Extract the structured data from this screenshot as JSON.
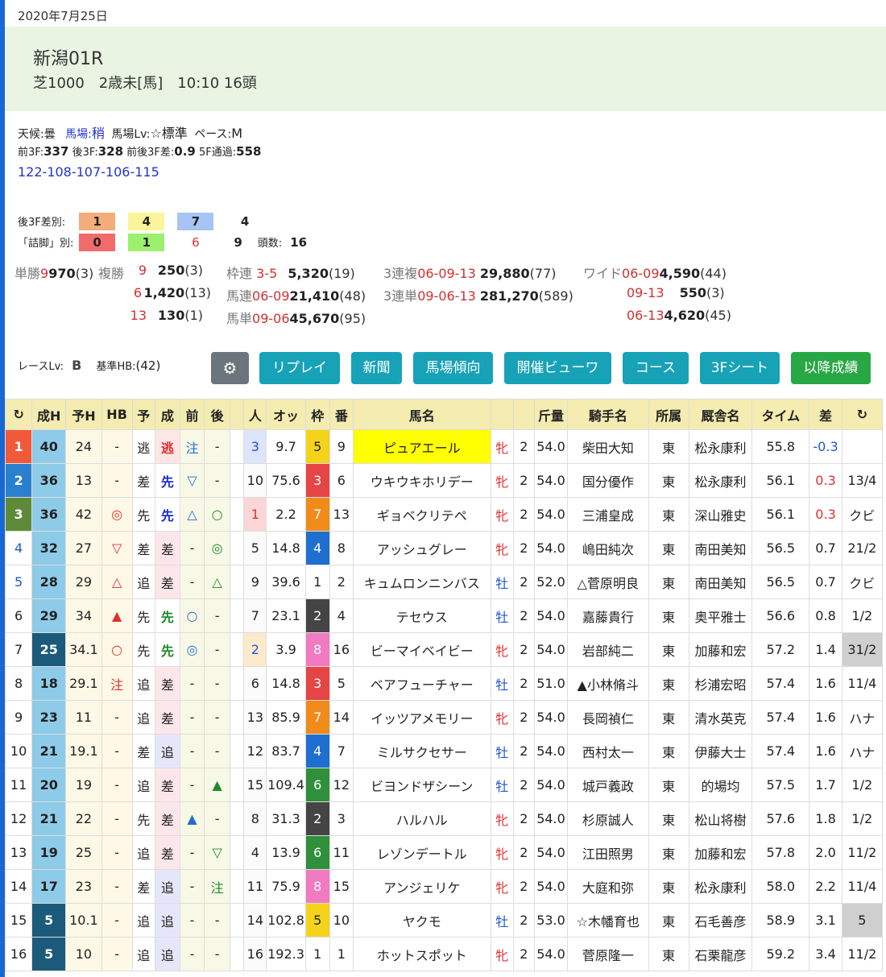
{
  "date": "2020年7月25日",
  "race": {
    "title": "新潟01R",
    "sub": "芝1000　2歳未[馬]　10:10 16頭"
  },
  "cond": {
    "weather_label": "天候:",
    "weather": "曇",
    "baba_label": "馬場:",
    "baba": "稍",
    "babalv_label": "馬場Lv:",
    "babalv": "☆標準",
    "pace_label": "ペース:",
    "pace": "M",
    "f3_label": "前3F:",
    "f3": "337",
    "l3_label": "後3F:",
    "l3": "328",
    "diff_label": "前後3F差:",
    "diff": "0.9",
    "f5_label": "5F通過:",
    "f5": "558",
    "laps": "122-108-107-106-115"
  },
  "stats": {
    "l3_label": "後3F差別:",
    "l3_values": [
      "1",
      "4",
      "7",
      "4"
    ],
    "tsume_label": "「詰脚」別:",
    "tsume_values": [
      "0",
      "1",
      "6",
      "9"
    ],
    "heads_label": "頭数:",
    "heads": "16"
  },
  "payouts": {
    "tan_label": "単勝",
    "tan_num": "9",
    "tan_val": "970",
    "tan_pop": "(3)",
    "fuku_label": "複勝",
    "fuku": [
      {
        "num": "9",
        "val": "250",
        "pop": "(3)"
      },
      {
        "num": "6",
        "val": "1,420",
        "pop": "(13)"
      },
      {
        "num": "13",
        "val": "130",
        "pop": "(1)"
      }
    ],
    "waku_label": "枠連",
    "waku_num": "3-5",
    "waku_val": "5,320",
    "waku_pop": "(19)",
    "umaren_label": "馬連",
    "umaren_num": "06-09",
    "umaren_val": "21,410",
    "umaren_pop": "(48)",
    "umatan_label": "馬単",
    "umatan_num": "09-06",
    "umatan_val": "45,670",
    "umatan_pop": "(95)",
    "trio_label": "3連複",
    "trio_num": "06-09-13",
    "trio_val": "29,880",
    "trio_pop": "(77)",
    "trifecta_label": "3連単",
    "trifecta_num": "09-06-13",
    "trifecta_val": "281,270",
    "trifecta_pop": "(589)",
    "wide_label": "ワイド",
    "wide": [
      {
        "num": "06-09",
        "val": "4,590",
        "pop": "(44)"
      },
      {
        "num": "09-13",
        "val": "550",
        "pop": "(3)"
      },
      {
        "num": "06-13",
        "val": "4,620",
        "pop": "(45)"
      }
    ]
  },
  "racelv": {
    "label": "レースLv:",
    "value": "B",
    "hb_label": "基準HB:",
    "hb": "(42)"
  },
  "buttons": [
    "リプレイ",
    "新聞",
    "馬場傾向",
    "開催ビューワ",
    "コース",
    "3Fシート",
    "以降成績"
  ],
  "colors": {
    "btn_teal": "#17a2b8",
    "btn_green": "#28a745",
    "btn_gray": "#6c757d",
    "header_bg": "#e9f4e2"
  },
  "table": {
    "headers": [
      "↻",
      "成H",
      "予H",
      "HB",
      "予",
      "成",
      "前",
      "後",
      "",
      "人",
      "オッ",
      "枠",
      "番",
      "馬名",
      "",
      "",
      "斤量",
      "騎手名",
      "所属",
      "厩舎名",
      "タイム",
      "差",
      "↻"
    ],
    "rows": [
      {
        "rank": "1",
        "seih": "40",
        "yoh": "24",
        "hb": "-",
        "yo": "逃",
        "sei": "逃",
        "mae": "注",
        "ato": "-",
        "ninki": "3",
        "odds": "9.7",
        "waku": "5",
        "ban": "9",
        "name": "ピュアエール",
        "sex": "牝",
        "age": "2",
        "kin": "54.0",
        "jockey": "柴田大知",
        "aff": "東",
        "trainer": "松永康利",
        "time": "55.8",
        "sa": "-0.3",
        "mg": ""
      },
      {
        "rank": "2",
        "seih": "36",
        "yoh": "13",
        "hb": "-",
        "yo": "差",
        "sei": "先",
        "mae": "▽",
        "ato": "-",
        "ninki": "10",
        "odds": "75.6",
        "waku": "3",
        "ban": "6",
        "name": "ウキウキホリデー",
        "sex": "牝",
        "age": "2",
        "kin": "54.0",
        "jockey": "国分優作",
        "aff": "東",
        "trainer": "松永康利",
        "time": "56.1",
        "sa": "0.3",
        "mg": "13/4"
      },
      {
        "rank": "3",
        "seih": "36",
        "yoh": "42",
        "hb": "◎",
        "yo": "先",
        "sei": "先",
        "mae": "△",
        "ato": "○",
        "ninki": "1",
        "odds": "2.2",
        "waku": "7",
        "ban": "13",
        "name": "ギョベクリテペ",
        "sex": "牝",
        "age": "2",
        "kin": "54.0",
        "jockey": "三浦皇成",
        "aff": "東",
        "trainer": "深山雅史",
        "time": "56.1",
        "sa": "0.3",
        "mg": "クビ"
      },
      {
        "rank": "4",
        "seih": "32",
        "yoh": "27",
        "hb": "▽",
        "yo": "差",
        "sei": "差",
        "mae": "-",
        "ato": "◎",
        "ninki": "5",
        "odds": "14.8",
        "waku": "4",
        "ban": "8",
        "name": "アッシュグレー",
        "sex": "牝",
        "age": "2",
        "kin": "54.0",
        "jockey": "嶋田純次",
        "aff": "東",
        "trainer": "南田美知",
        "time": "56.5",
        "sa": "0.7",
        "mg": "21/2"
      },
      {
        "rank": "5",
        "seih": "28",
        "yoh": "29",
        "hb": "△",
        "yo": "追",
        "sei": "差",
        "mae": "-",
        "ato": "△",
        "ninki": "9",
        "odds": "39.6",
        "waku": "1",
        "ban": "2",
        "name": "キュムロンニンバス",
        "sex": "牡",
        "age": "2",
        "kin": "52.0",
        "jockey": "△菅原明良",
        "aff": "東",
        "trainer": "南田美知",
        "time": "56.5",
        "sa": "0.7",
        "mg": "クビ"
      },
      {
        "rank": "6",
        "seih": "29",
        "yoh": "34",
        "hb": "▲",
        "yo": "先",
        "sei": "先",
        "mae": "○",
        "ato": "-",
        "ninki": "7",
        "odds": "23.1",
        "waku": "2",
        "ban": "4",
        "name": "テセウス",
        "sex": "牡",
        "age": "2",
        "kin": "54.0",
        "jockey": "嘉藤貴行",
        "aff": "東",
        "trainer": "奥平雅士",
        "time": "56.6",
        "sa": "0.8",
        "mg": "1/2"
      },
      {
        "rank": "7",
        "seih": "25",
        "yoh": "34.1",
        "hb": "○",
        "yo": "先",
        "sei": "先",
        "mae": "◎",
        "ato": "-",
        "ninki": "2",
        "odds": "3.9",
        "waku": "8",
        "ban": "16",
        "name": "ビーマイベイビー",
        "sex": "牝",
        "age": "2",
        "kin": "54.0",
        "jockey": "岩部純二",
        "aff": "東",
        "trainer": "加藤和宏",
        "time": "57.2",
        "sa": "1.4",
        "mg": "31/2"
      },
      {
        "rank": "8",
        "seih": "18",
        "yoh": "29.1",
        "hb": "注",
        "yo": "追",
        "sei": "差",
        "mae": "-",
        "ato": "-",
        "ninki": "6",
        "odds": "14.8",
        "waku": "3",
        "ban": "5",
        "name": "ベアフューチャー",
        "sex": "牡",
        "age": "2",
        "kin": "51.0",
        "jockey": "▲小林脩斗",
        "aff": "東",
        "trainer": "杉浦宏昭",
        "time": "57.4",
        "sa": "1.6",
        "mg": "11/4"
      },
      {
        "rank": "9",
        "seih": "23",
        "yoh": "11",
        "hb": "-",
        "yo": "追",
        "sei": "差",
        "mae": "-",
        "ato": "-",
        "ninki": "13",
        "odds": "85.9",
        "waku": "7",
        "ban": "14",
        "name": "イッツアメモリー",
        "sex": "牝",
        "age": "2",
        "kin": "54.0",
        "jockey": "長岡禎仁",
        "aff": "東",
        "trainer": "清水英克",
        "time": "57.4",
        "sa": "1.6",
        "mg": "ハナ"
      },
      {
        "rank": "10",
        "seih": "21",
        "yoh": "19.1",
        "hb": "-",
        "yo": "差",
        "sei": "追",
        "mae": "-",
        "ato": "-",
        "ninki": "12",
        "odds": "83.7",
        "waku": "4",
        "ban": "7",
        "name": "ミルサクセサー",
        "sex": "牡",
        "age": "2",
        "kin": "54.0",
        "jockey": "西村太一",
        "aff": "東",
        "trainer": "伊藤大士",
        "time": "57.4",
        "sa": "1.6",
        "mg": "ハナ"
      },
      {
        "rank": "11",
        "seih": "20",
        "yoh": "19",
        "hb": "-",
        "yo": "追",
        "sei": "差",
        "mae": "-",
        "ato": "▲",
        "ninki": "15",
        "odds": "109.4",
        "waku": "6",
        "ban": "12",
        "name": "ビヨンドザシーン",
        "sex": "牡",
        "age": "2",
        "kin": "54.0",
        "jockey": "城戸義政",
        "aff": "東",
        "trainer": "的場均",
        "time": "57.5",
        "sa": "1.7",
        "mg": "1/2"
      },
      {
        "rank": "12",
        "seih": "21",
        "yoh": "22",
        "hb": "-",
        "yo": "先",
        "sei": "差",
        "mae": "▲",
        "ato": "-",
        "ninki": "8",
        "odds": "31.3",
        "waku": "2",
        "ban": "3",
        "name": "ハルハル",
        "sex": "牝",
        "age": "2",
        "kin": "54.0",
        "jockey": "杉原誠人",
        "aff": "東",
        "trainer": "松山将樹",
        "time": "57.6",
        "sa": "1.8",
        "mg": "1/2"
      },
      {
        "rank": "13",
        "seih": "19",
        "yoh": "25",
        "hb": "-",
        "yo": "追",
        "sei": "差",
        "mae": "-",
        "ato": "▽",
        "ninki": "4",
        "odds": "13.9",
        "waku": "6",
        "ban": "11",
        "name": "レゾンデートル",
        "sex": "牝",
        "age": "2",
        "kin": "54.0",
        "jockey": "江田照男",
        "aff": "東",
        "trainer": "加藤和宏",
        "time": "57.8",
        "sa": "2.0",
        "mg": "11/2"
      },
      {
        "rank": "14",
        "seih": "17",
        "yoh": "23",
        "hb": "-",
        "yo": "差",
        "sei": "追",
        "mae": "-",
        "ato": "注",
        "ninki": "11",
        "odds": "75.9",
        "waku": "8",
        "ban": "15",
        "name": "アンジェリケ",
        "sex": "牝",
        "age": "2",
        "kin": "54.0",
        "jockey": "大庭和弥",
        "aff": "東",
        "trainer": "松永康利",
        "time": "58.0",
        "sa": "2.2",
        "mg": "11/4"
      },
      {
        "rank": "15",
        "seih": "5",
        "yoh": "10.1",
        "hb": "-",
        "yo": "追",
        "sei": "追",
        "mae": "-",
        "ato": "-",
        "ninki": "14",
        "odds": "102.8",
        "waku": "5",
        "ban": "10",
        "name": "ヤクモ",
        "sex": "牡",
        "age": "2",
        "kin": "53.0",
        "jockey": "☆木幡育也",
        "aff": "東",
        "trainer": "石毛善彦",
        "time": "58.9",
        "sa": "3.1",
        "mg": "5"
      },
      {
        "rank": "16",
        "seih": "5",
        "yoh": "10",
        "hb": "-",
        "yo": "追",
        "sei": "追",
        "mae": "-",
        "ato": "-",
        "ninki": "16",
        "odds": "192.3",
        "waku": "1",
        "ban": "1",
        "name": "ホットスポット",
        "sex": "牝",
        "age": "2",
        "kin": "54.0",
        "jockey": "菅原隆一",
        "aff": "東",
        "trainer": "石栗龍彦",
        "time": "59.2",
        "sa": "3.4",
        "mg": "11/2"
      }
    ]
  }
}
